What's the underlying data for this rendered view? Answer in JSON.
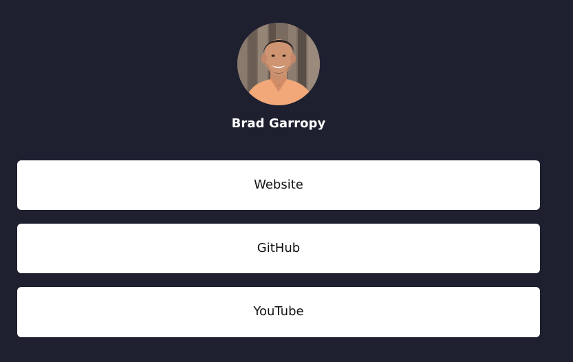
{
  "profile": {
    "name": "Brad Garropy",
    "avatar_icon": "profile-photo"
  },
  "links": [
    {
      "label": "Website"
    },
    {
      "label": "GitHub"
    },
    {
      "label": "YouTube"
    }
  ],
  "colors": {
    "background": "#1e2030",
    "button_bg": "#ffffff",
    "button_text": "#111111",
    "name_text": "#ffffff"
  }
}
